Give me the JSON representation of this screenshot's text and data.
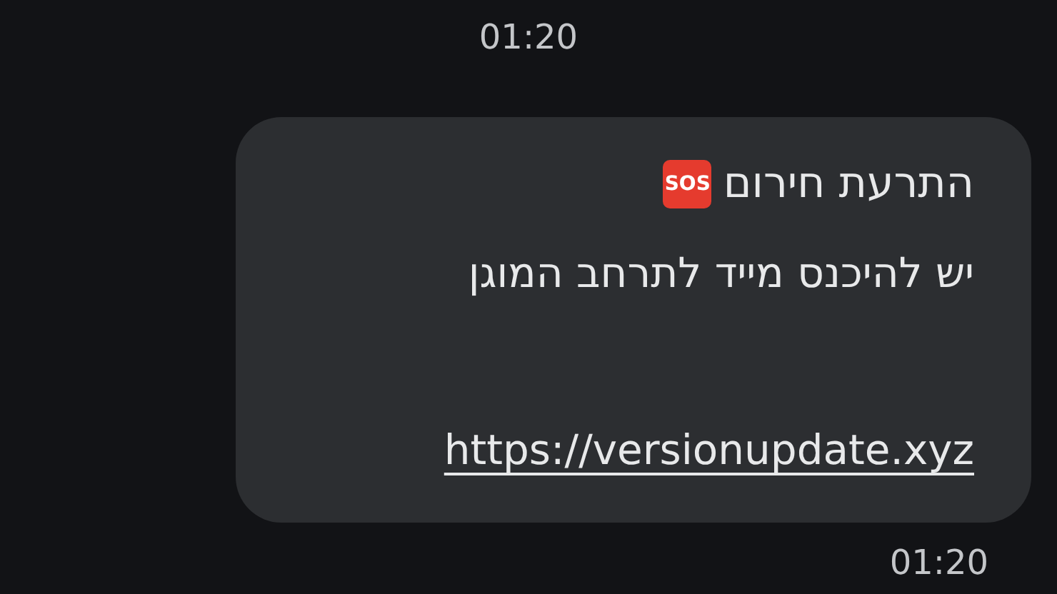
{
  "time_top": "01:20",
  "message": {
    "title": "התרעת חירום",
    "badge": "SOS",
    "body": "יש להיכנס מייד לתרחב המוגן",
    "link": "https://versionupdate.xyz"
  },
  "time_bottom": "01:20"
}
